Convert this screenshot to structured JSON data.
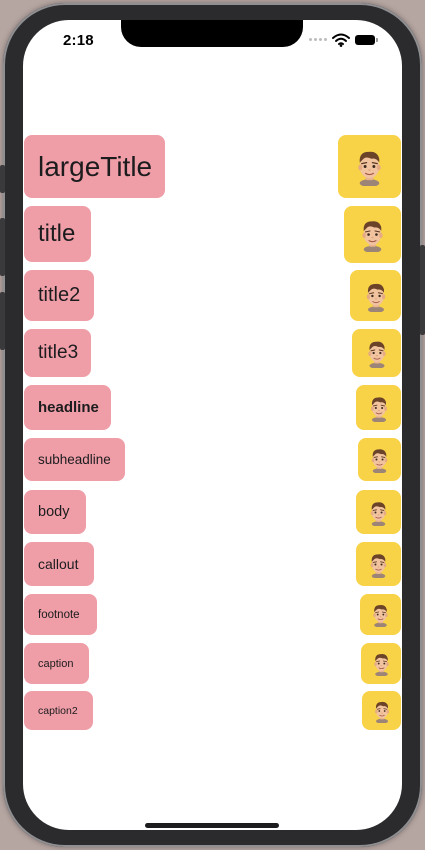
{
  "status_bar": {
    "time": "2:18"
  },
  "rows": [
    {
      "label": "largeTitle"
    },
    {
      "label": "title"
    },
    {
      "label": "title2"
    },
    {
      "label": "title3"
    },
    {
      "label": "headline"
    },
    {
      "label": "subheadline"
    },
    {
      "label": "body"
    },
    {
      "label": "callout"
    },
    {
      "label": "footnote"
    },
    {
      "label": "caption"
    },
    {
      "label": "caption2"
    }
  ],
  "icons": {
    "avatar": "memoji-avatar-icon"
  },
  "colors": {
    "label_bg": "#ef9ea8",
    "avatar_bg": "#f8d247"
  }
}
